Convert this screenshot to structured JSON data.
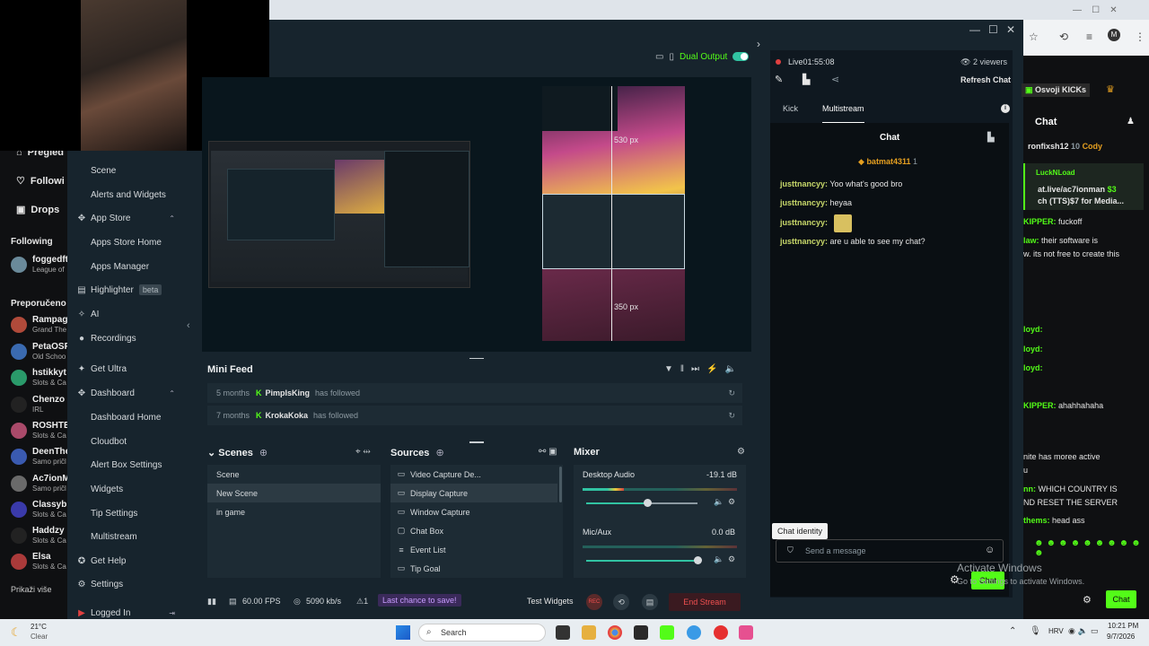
{
  "titlebar": {
    "min": "—",
    "max": "☐",
    "close": "✕"
  },
  "dual_output": {
    "label": "Dual Output"
  },
  "side_menu": {
    "items": [
      {
        "label": "Scene",
        "sub": true
      },
      {
        "label": "Alerts and Widgets",
        "sub": true
      },
      {
        "label": "App Store",
        "sub": false,
        "icon": "app-store-icon"
      },
      {
        "label": "Apps Store Home",
        "sub": true
      },
      {
        "label": "Apps Manager",
        "sub": true
      },
      {
        "label": "Highlighter",
        "sub": false,
        "badge": "beta"
      },
      {
        "label": "AI",
        "sub": false
      },
      {
        "label": "Recordings",
        "sub": false
      },
      {
        "label": "Get Ultra",
        "sub": false
      },
      {
        "label": "Dashboard",
        "sub": false
      },
      {
        "label": "Dashboard Home",
        "sub": true
      },
      {
        "label": "Cloudbot",
        "sub": true
      },
      {
        "label": "Alert Box Settings",
        "sub": true
      },
      {
        "label": "Widgets",
        "sub": true
      },
      {
        "label": "Tip Settings",
        "sub": true
      },
      {
        "label": "Multistream",
        "sub": true
      },
      {
        "label": "Get Help",
        "sub": false
      },
      {
        "label": "Settings",
        "sub": false
      },
      {
        "label": "Logged In",
        "sub": false
      }
    ]
  },
  "kick_left": {
    "nav": [
      "Pregled",
      "Followi",
      "Drops"
    ],
    "following": "Following",
    "recommended": "Preporučeno",
    "users": [
      {
        "name": "foggedft",
        "sub": "League of"
      },
      {
        "name": "Rampag",
        "sub": "Grand The"
      },
      {
        "name": "PetaOSR",
        "sub": "Old Schoo"
      },
      {
        "name": "hstikkyt",
        "sub": "Slots & Ca"
      },
      {
        "name": "Chenzo",
        "sub": "IRL"
      },
      {
        "name": "ROSHTE",
        "sub": "Slots & Ca"
      },
      {
        "name": "DeenThe",
        "sub": "Samo pričl"
      },
      {
        "name": "Ac7ionM",
        "sub": "Samo pričl"
      },
      {
        "name": "Classyb",
        "sub": "Slots & Ca"
      },
      {
        "name": "Haddzy",
        "sub": "Slots & Ca"
      },
      {
        "name": "Elsa",
        "sub": "Slots & Ca"
      }
    ],
    "more": "Prikaži više"
  },
  "editor": {
    "px_top": "530 px",
    "px_bottom": "350 px"
  },
  "minifeed": {
    "title": "Mini Feed",
    "rows": [
      {
        "time": "5 months",
        "name": "PimpIsKing",
        "action": "has followed"
      },
      {
        "time": "7 months",
        "name": "KrokaKoka",
        "action": "has followed"
      }
    ]
  },
  "scenes": {
    "title": "Scenes",
    "items": [
      "Scene",
      "New Scene",
      "in game"
    ],
    "selected": 1
  },
  "sources": {
    "title": "Sources",
    "items": [
      "Video Capture De...",
      "Display Capture",
      "Window Capture",
      "Chat Box",
      "Event List",
      "Tip Goal"
    ],
    "selected": 1
  },
  "mixer": {
    "title": "Mixer",
    "items": [
      {
        "name": "Desktop Audio",
        "db": "-19.1 dB",
        "level": 0.55
      },
      {
        "name": "Mic/Aux",
        "db": "0.0 dB",
        "level": 1.0
      }
    ]
  },
  "footer": {
    "fps": "60.00 FPS",
    "kbs": "5090 kb/s",
    "alert_count": "1",
    "last_chance": "Last chance to save!",
    "test_widgets": "Test Widgets",
    "end_stream": "End Stream"
  },
  "chat": {
    "live": "Live",
    "time": "01:55:08",
    "viewers": "2 viewers",
    "refresh": "Refresh Chat",
    "tabs": [
      "Kick",
      "Multistream"
    ],
    "header": "Chat",
    "pinned_user": "batmat4311",
    "pinned_count": "1",
    "messages": [
      {
        "user": "justtnancyy:",
        "text": "Yoo what's good bro"
      },
      {
        "user": "justtnancyy:",
        "text": "heyaa"
      },
      {
        "user": "justtnancyy:",
        "text": ""
      },
      {
        "user": "justtnancyy:",
        "text": "are u able to see my chat?"
      }
    ],
    "identity": "Chat identity",
    "placeholder": "Send a message",
    "button": "Chat"
  },
  "kick_right": {
    "header": "Chat",
    "kicks": "Osvoji KICKs",
    "top_users": [
      "ronfixsh12",
      "10",
      "Cody"
    ],
    "pinned_name": "LuckNLoad",
    "pinned_line1": "at.live/ac7ionman",
    "pinned_amount": "$3",
    "pinned_line2": "ch (TTS)$7 for Media...",
    "lines": [
      {
        "user": "KIPPER:",
        "text": "fuckoff"
      },
      {
        "user": "law:",
        "text": "their software is"
      },
      {
        "user": "",
        "text": "w. its not free to create this"
      },
      {
        "user": "loyd:",
        "text": ""
      },
      {
        "user": "loyd:",
        "text": ""
      },
      {
        "user": "loyd:",
        "text": ""
      },
      {
        "user": "KIPPER:",
        "text": "ahahhahaha"
      },
      {
        "user": "",
        "text": "nite has moree active"
      },
      {
        "user": "",
        "text": "u"
      },
      {
        "user": "nn:",
        "text": "WHICH COUNTRY IS"
      },
      {
        "user": "",
        "text": "ND RESET THE SERVER"
      },
      {
        "user": "thems:",
        "text": "head ass"
      }
    ],
    "button": "Chat"
  },
  "activate": {
    "title": "Activate Windows",
    "sub": "Go to Settings to activate Windows."
  },
  "taskbar": {
    "weather_temp": "21°C",
    "weather_desc": "Clear",
    "search": "Search",
    "lang": "HRV",
    "time": "10:21 PM",
    "date": "9/7/2026"
  }
}
